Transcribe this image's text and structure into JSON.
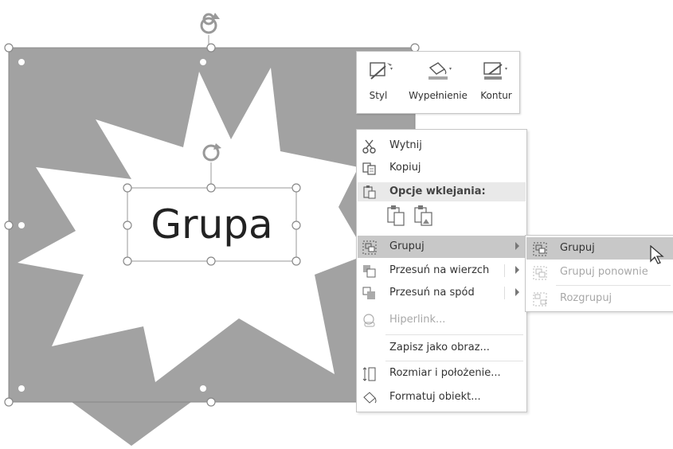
{
  "shape": {
    "label": "Grupa"
  },
  "mini_toolbar": {
    "buttons": [
      {
        "label": "Styl",
        "icon": "style-icon"
      },
      {
        "label": "Wypełnienie",
        "icon": "fill-bucket-icon"
      },
      {
        "label": "Kontur",
        "icon": "outline-pen-icon"
      }
    ]
  },
  "context_menu": {
    "cut": "Wytnij",
    "copy": "Kopiuj",
    "paste_options": "Opcje wklejania:",
    "group": "Grupuj",
    "bring_to_front": "Przesuń na wierzch",
    "send_to_back": "Przesuń na spód",
    "hyperlink": "Hiperlink...",
    "save_as_picture": "Zapisz jako obraz...",
    "size_position": "Rozmiar i położenie...",
    "format_object": "Formatuj obiekt..."
  },
  "submenu": {
    "group": "Grupuj",
    "regroup": "Grupuj ponownie",
    "ungroup": "Rozgrupuj"
  },
  "colors": {
    "shape_fill": "#a0a0a0",
    "highlight": "#c8c8c8",
    "handle": "#ffffff"
  }
}
